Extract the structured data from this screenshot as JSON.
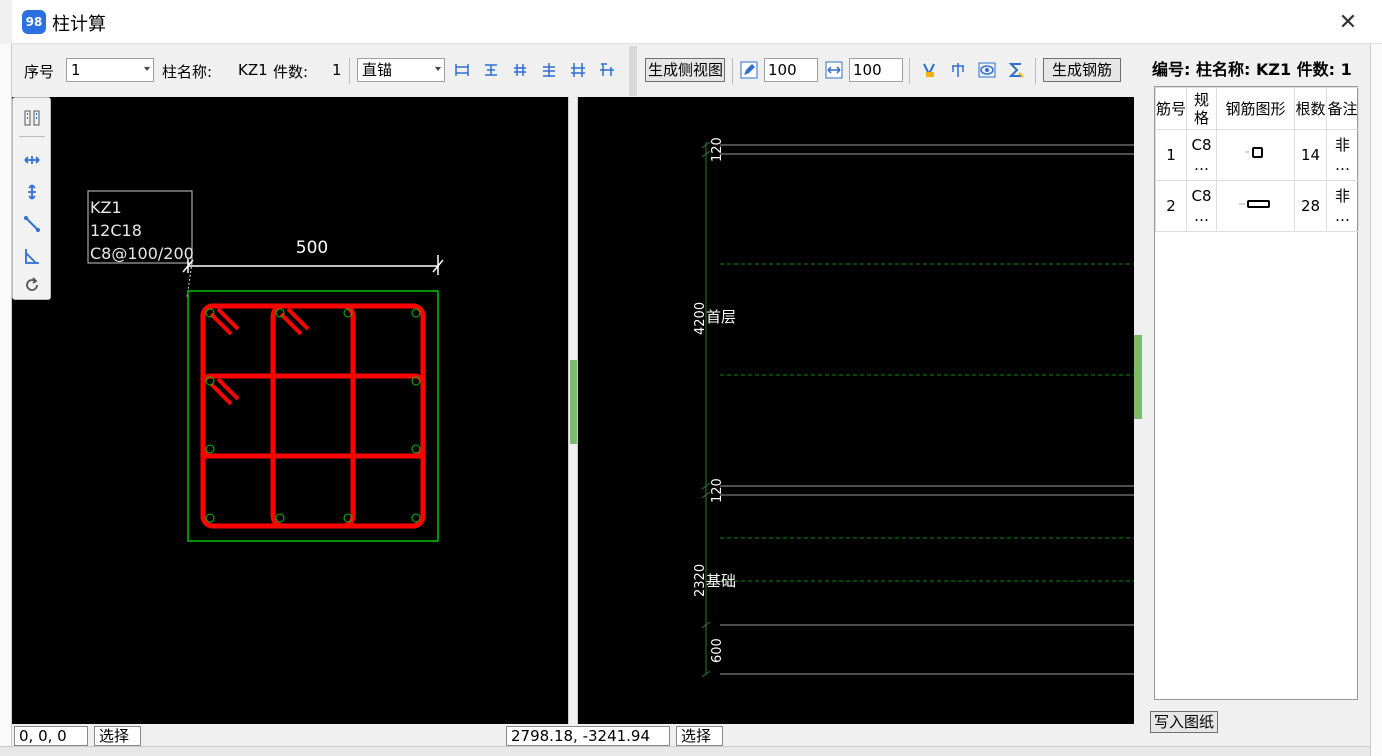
{
  "window": {
    "title": "柱计算",
    "icon": "app-logo-icon",
    "close": "✕"
  },
  "toolbar": {
    "seq_label": "序号",
    "seq_value": "1",
    "col_name_label": "柱名称:",
    "col_name_value": "KZ1",
    "count_label": "件数:",
    "count_value": "1",
    "anchor_value": "直锚",
    "gen_side_view_label": "生成侧视图",
    "spacing_a": "100",
    "spacing_b": "100",
    "gen_rebar_label": "生成钢筋",
    "icons_left": [
      "rebar-layout-1-icon",
      "rebar-layout-2-icon",
      "rebar-layout-3-icon",
      "rebar-layout-4-icon",
      "rebar-layout-5-icon",
      "rebar-layout-6-icon"
    ],
    "icons_mid": [
      "edit-icon",
      "width-icon",
      "fill-icon",
      "split-icon",
      "eye-icon",
      "sigma-icon"
    ]
  },
  "palette": {
    "icons": [
      "layout-icon",
      "move-horizontal-icon",
      "move-vertical-icon",
      "diagonal-line-icon",
      "angle-icon",
      "rotate-icon"
    ]
  },
  "canvas_left": {
    "label_lines": [
      "KZ1",
      "12C18",
      "C8@100/200"
    ],
    "dimension": "500"
  },
  "canvas_right": {
    "dims": [
      "120",
      "4200",
      "120",
      "2320",
      "600"
    ],
    "floors": [
      "首层",
      "基础"
    ]
  },
  "status": {
    "coord_left": "0, 0, 0",
    "mode_left": "选择",
    "coord_right": "2798.18, -3241.94",
    "mode_right": "选择"
  },
  "panel": {
    "header": "编号: 柱名称: KZ1 件数: 1",
    "columns": [
      "筋号",
      "规格",
      "钢筋图形",
      "根数",
      "备注"
    ],
    "rows": [
      {
        "no": "1",
        "spec": "C8 …",
        "count": "14",
        "note": "非 …"
      },
      {
        "no": "2",
        "spec": "C8 …",
        "count": "28",
        "note": "非 …"
      }
    ],
    "write_label": "写入图纸"
  },
  "colors": {
    "rebar": "#ff0000",
    "section": "#00c000",
    "canvas_bg": "#000000",
    "grip": "#7dbb6c"
  }
}
